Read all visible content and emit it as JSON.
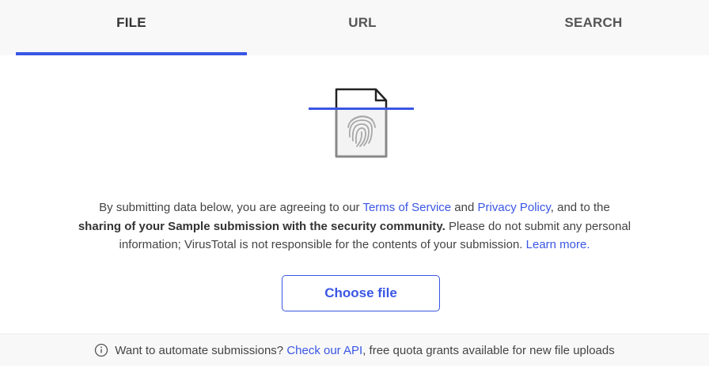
{
  "tabs": [
    {
      "label": "FILE",
      "active": true
    },
    {
      "label": "URL",
      "active": false
    },
    {
      "label": "SEARCH",
      "active": false
    }
  ],
  "illustration": {
    "icon": "fingerprint-file-scan-icon"
  },
  "notice": {
    "part1": "By submitting data below, you are agreeing to our ",
    "terms_link": "Terms of Service",
    "part2": " and ",
    "privacy_link": "Privacy Policy",
    "part3": ", and to the",
    "bold_text": "sharing of your Sample submission with the security community.",
    "part4": " Please do not submit any personal",
    "part5": "information; VirusTotal is not responsible for the contents of your submission. ",
    "learn_more_link": "Learn more."
  },
  "choose_file_button": "Choose file",
  "footer": {
    "icon": "info-icon",
    "text_before": "Want to automate submissions? ",
    "api_link": "Check our API",
    "text_after": ", free quota grants available for new file uploads"
  },
  "colors": {
    "accent": "#3a56e4",
    "tab_bar_bg": "#f8f8f8",
    "text": "#444444"
  }
}
